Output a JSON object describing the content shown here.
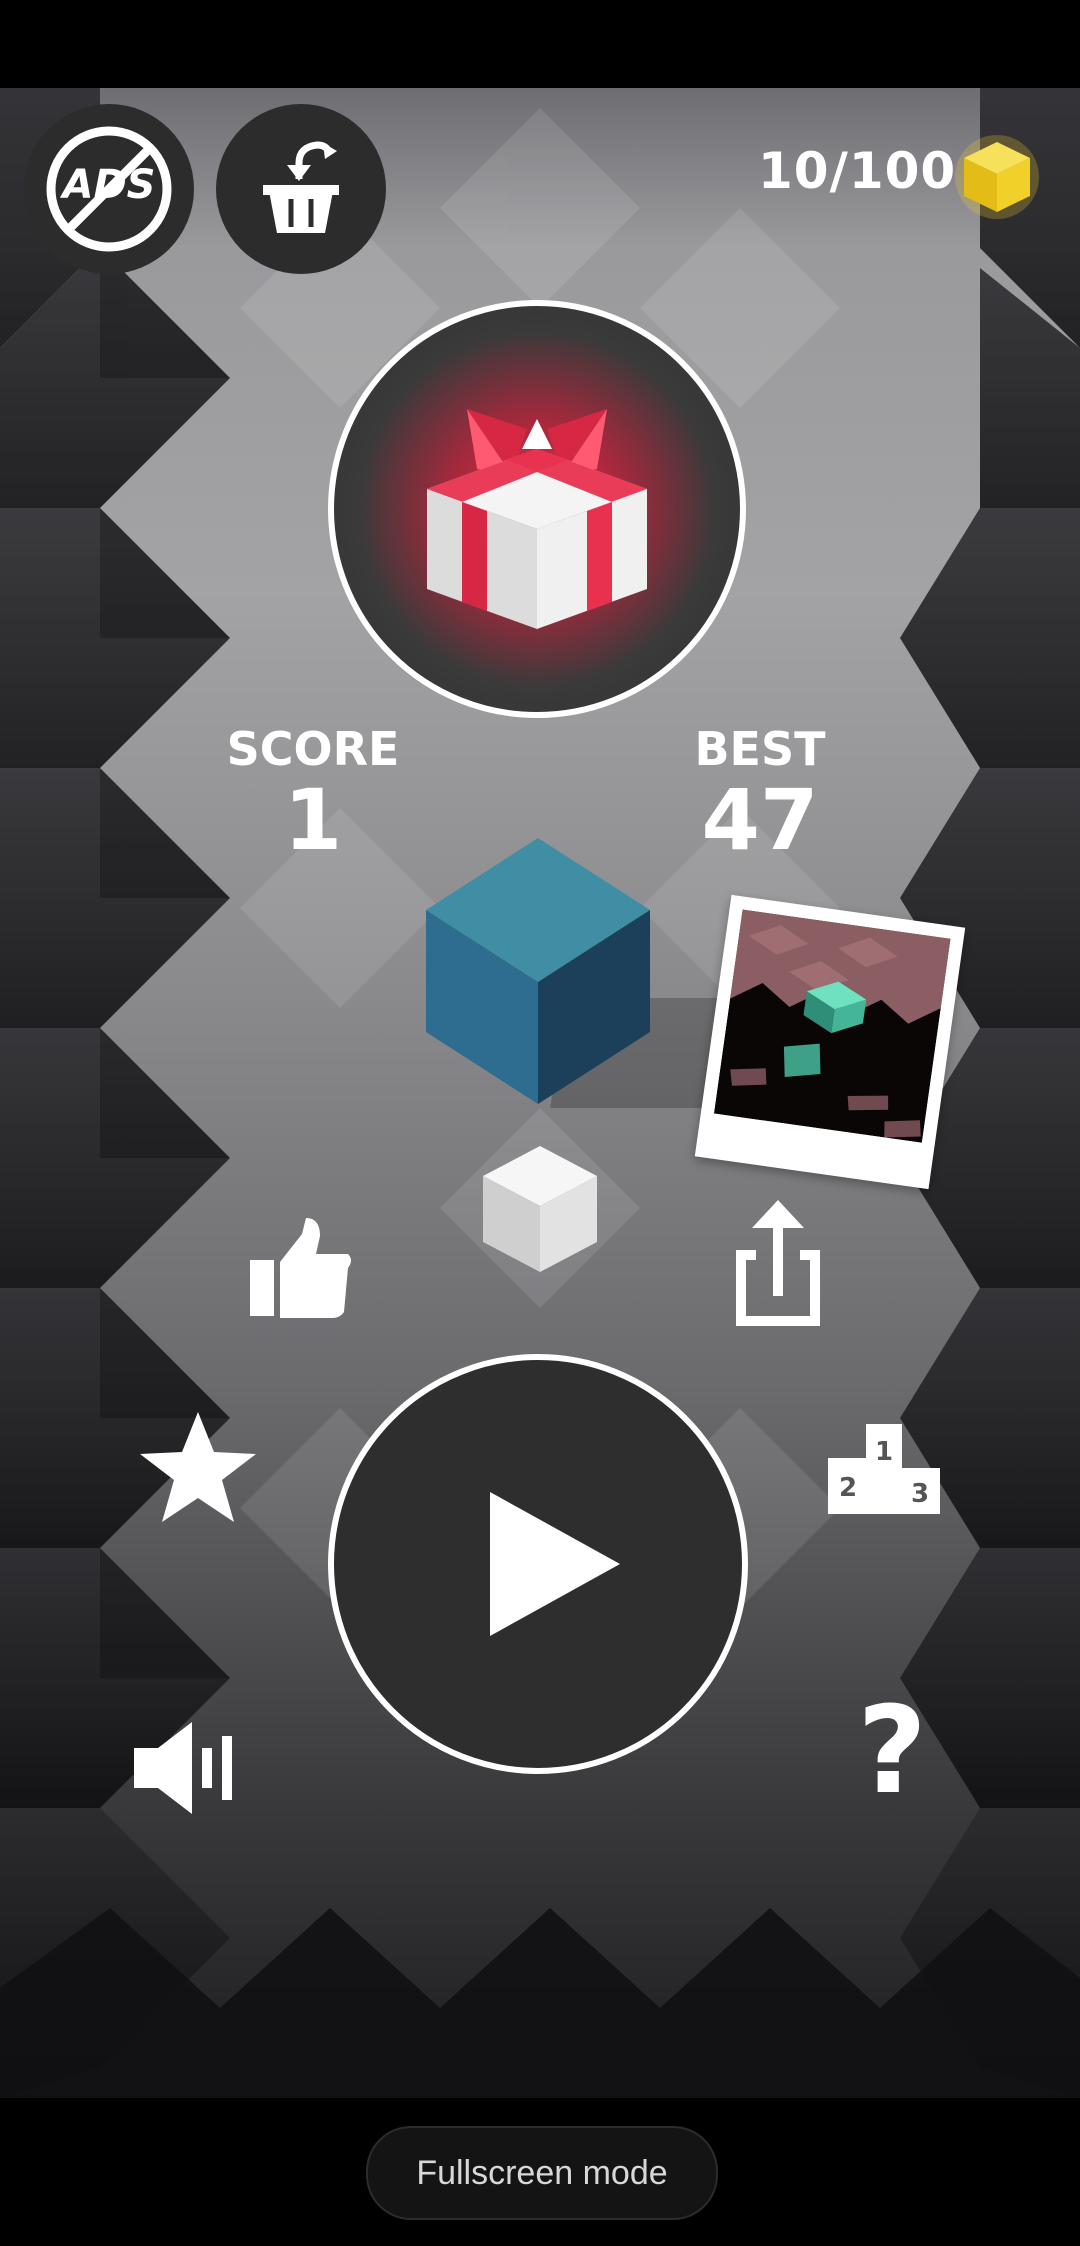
{
  "header": {
    "coin_counter": "10/100",
    "no_ads_label": "ADS"
  },
  "scores": {
    "score_label": "SCORE",
    "score_value": "1",
    "best_label": "BEST",
    "best_value": "47"
  },
  "help_label": "?",
  "podium_numbers": [
    "2",
    "1",
    "3"
  ],
  "footer": {
    "fullscreen_label": "Fullscreen mode"
  },
  "colors": {
    "gift_red": "#e8314f",
    "player_cube": "#3b8aa3",
    "coin_yellow": "#f2d02a",
    "button_dark": "#333333"
  },
  "icons": [
    "no-ads-icon",
    "shop-basket-icon",
    "coin-cube-icon",
    "gift-icon",
    "like-icon",
    "share-icon",
    "star-icon",
    "leaderboard-icon",
    "play-icon",
    "sound-icon",
    "help-icon"
  ]
}
